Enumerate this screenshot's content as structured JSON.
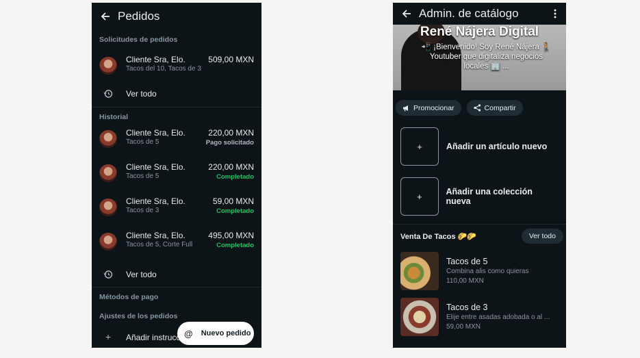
{
  "left": {
    "title": "Pedidos",
    "requests_header": "Solicitudes de pedidos",
    "request": {
      "name": "Cliente Sra, Elo.",
      "items": "Tacos del 10, Tacos de 3",
      "amount": "509,00 MXN"
    },
    "view_all_1": "Ver todo",
    "history_header": "Historial",
    "history": [
      {
        "name": "Cliente Sra, Elo.",
        "items": "Tacos de 5",
        "amount": "220,00 MXN",
        "status": "Pago solicitado"
      },
      {
        "name": "Cliente Sra, Elo.",
        "items": "Tacos de 5",
        "amount": "220,00 MXN",
        "status": "Completado"
      },
      {
        "name": "Cliente Sra, Elo.",
        "items": "Tacos de 3",
        "amount": "59,00 MXN",
        "status": "Completado"
      },
      {
        "name": "Cliente Sra, Elo.",
        "items": "Tacos de 5, Corte Full",
        "amount": "495,00 MXN",
        "status": "Completado"
      }
    ],
    "view_all_2": "Ver todo",
    "payment_header": "Métodos de pago",
    "settings_header": "Ajustes de los pedidos",
    "add_instructions": "Añadir instrucciones para client...",
    "fab_label": "Nuevo pedido",
    "fab_icon": "@"
  },
  "right": {
    "title": "Admin. de catálogo",
    "cover_title": "René Nájera Digital",
    "cover_sub": "📲 ¡Bienvenido! Soy René Nájera 🚶 Youtuber que digitaliza negocios locales 🏢 ...",
    "promote": "Promocionar",
    "share": "Compartir",
    "add_item": "Añadir un artículo nuevo",
    "add_collection": "Añadir una colección nueva",
    "plus": "+",
    "collection_title": "Venta De Tacos 🌮🌮",
    "collection_view_all": "Ver todo",
    "items": [
      {
        "name": "Tacos de 5",
        "desc": "Combina alis como quieras",
        "price": "110,00 MXN"
      },
      {
        "name": "Tacos de 3",
        "desc": "Elije entre asadas adobada o al ...",
        "price": "59,00 MXN"
      }
    ]
  },
  "colors": {
    "bg_dark": "#0d1417",
    "accent_green": "#21c063",
    "muted": "#8696a0"
  },
  "icons": [
    "back-arrow-icon",
    "history-icon",
    "at-icon",
    "kebab-icon",
    "megaphone-icon",
    "share-icon",
    "plus-icon"
  ]
}
